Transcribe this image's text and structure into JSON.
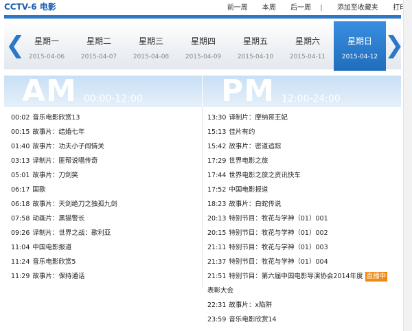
{
  "header": {
    "channel": "CCTV-6 电影",
    "links": [
      "前一周",
      "本周",
      "后一周",
      "|",
      "添加至收藏夹",
      "打印"
    ]
  },
  "days": [
    {
      "name": "星期一",
      "date": "2015-04-06"
    },
    {
      "name": "星期二",
      "date": "2015-04-07"
    },
    {
      "name": "星期三",
      "date": "2015-04-08"
    },
    {
      "name": "星期四",
      "date": "2015-04-09"
    },
    {
      "name": "星期五",
      "date": "2015-04-10"
    },
    {
      "name": "星期六",
      "date": "2015-04-11"
    },
    {
      "name": "星期日",
      "date": "2015-04-12"
    }
  ],
  "active_day_index": 6,
  "am": {
    "label": "AM",
    "range": "00:00-12:00"
  },
  "pm": {
    "label": "PM",
    "range": "12:00-24:00"
  },
  "am_items": [
    {
      "time": "00:02",
      "title": "音乐电影欣赏13"
    },
    {
      "time": "00:15",
      "title": "故事片：结婚七年"
    },
    {
      "time": "01:40",
      "title": "故事片：功夫小子闯情关"
    },
    {
      "time": "03:13",
      "title": "译制片：匪帮说唱传奇"
    },
    {
      "time": "05:01",
      "title": "故事片：刀剑笑"
    },
    {
      "time": "06:17",
      "title": "国歌"
    },
    {
      "time": "06:18",
      "title": "故事片：天剑绝刀之独孤九剑"
    },
    {
      "time": "07:58",
      "title": "动画片：黑猫警长"
    },
    {
      "time": "09:26",
      "title": "译制片：世界之战：歌利亚"
    },
    {
      "time": "11:04",
      "title": "中国电影报道"
    },
    {
      "time": "11:24",
      "title": "音乐电影欣赏5"
    },
    {
      "time": "11:29",
      "title": "故事片：保持通话"
    }
  ],
  "pm_items": [
    {
      "time": "13:30",
      "title": "译制片：摩纳哥王妃"
    },
    {
      "time": "15:13",
      "title": "佳片有约"
    },
    {
      "time": "15:42",
      "title": "故事片：密道追踪"
    },
    {
      "time": "17:29",
      "title": "世界电影之旅"
    },
    {
      "time": "17:44",
      "title": "世界电影之旅之资讯快车"
    },
    {
      "time": "17:52",
      "title": "中国电影报道"
    },
    {
      "time": "18:23",
      "title": "故事片：白蛇传说"
    },
    {
      "time": "20:13",
      "title": "特别节目：牧花与学神（01）001"
    },
    {
      "time": "20:15",
      "title": "特别节目：牧花与学神（01）002"
    },
    {
      "time": "21:11",
      "title": "特别节目：牧花与学神（01）003"
    },
    {
      "time": "21:37",
      "title": "特别节目：牧花与学神（01）004"
    }
  ],
  "pm_special": {
    "time": "21:51",
    "title": "特别节目：第六届中国电影导演协会2014年度",
    "badge": "直播中",
    "continuation": "表彰大会"
  },
  "pm_items_after": [
    {
      "time": "22:31",
      "title": "故事片：x陷阱"
    },
    {
      "time": "23:59",
      "title": "音乐电影欣赏14"
    }
  ],
  "colors": {
    "accent": "#2b78c8",
    "active_day": "#2272c3",
    "badge": "#f08a10"
  }
}
